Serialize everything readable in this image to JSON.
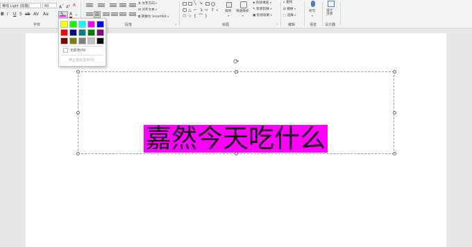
{
  "font": {
    "name": "等线 Light (标题)",
    "size": "60"
  },
  "text_group": {
    "direction": "文字方向",
    "align": "对齐文本",
    "smartart": "转换为 SmartArt"
  },
  "groups": {
    "font": "字体",
    "paragraph": "段落",
    "drawing": "绘图",
    "edit": "编辑",
    "voice": "语音",
    "designer": "设计器"
  },
  "drawing": {
    "arrange": "排列",
    "quick_styles": "快速样式",
    "fill": "形状填充",
    "outline": "形状轮廓",
    "effects": "形状效果"
  },
  "edit": {
    "find": "查找",
    "replace": "替换",
    "select": "选择"
  },
  "voice": {
    "dictate": "听写"
  },
  "designer": {
    "label": "设计\n灵感"
  },
  "highlight_menu": {
    "swatches": [
      "#ffff00",
      "#00ff00",
      "#00ffff",
      "#ff00ff",
      "#0000ff",
      "#ff0000",
      "#000080",
      "#008080",
      "#008000",
      "#800080",
      "#800000",
      "#808000",
      "#808080",
      "#c0c0c0",
      "#000000"
    ],
    "no_color": "无颜色(N)",
    "stop": "停止突出显示(S)"
  },
  "slide": {
    "headline": "嘉然今天吃什么",
    "highlight": "#ff00ff"
  }
}
